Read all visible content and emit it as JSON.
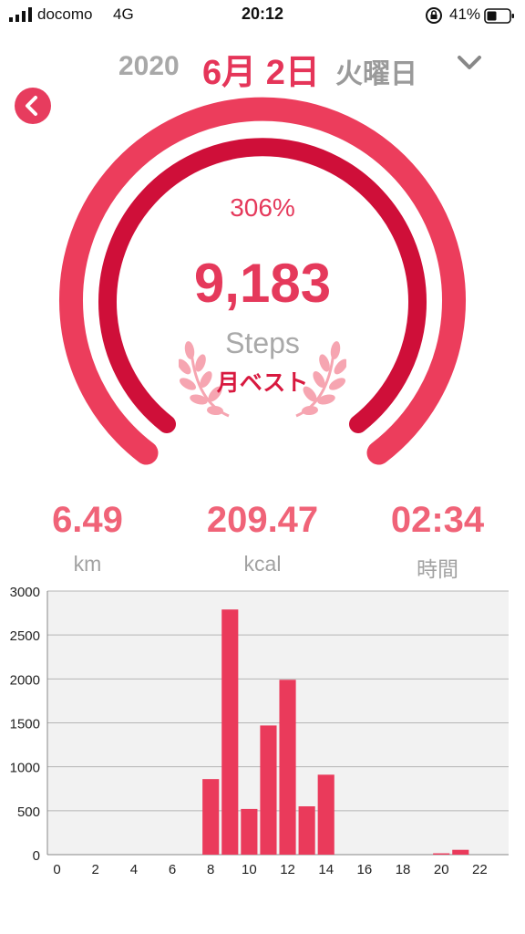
{
  "status_bar": {
    "carrier": "docomo",
    "network": "4G",
    "time": "20:12",
    "battery": "41%"
  },
  "header": {
    "year": "2020",
    "month_day": "6月 2日",
    "weekday": "火曜日"
  },
  "icons": {
    "back": "chevron-left-icon",
    "dropdown": "chevron-down-icon",
    "laurel": "laurel-icon",
    "lock": "rotation-lock-icon",
    "battery": "battery-icon",
    "signal": "signal-icon"
  },
  "summary": {
    "percent": "306%",
    "steps": "9,183",
    "steps_label": "Steps",
    "badge": "月ベスト"
  },
  "stats": [
    {
      "value": "6.49",
      "unit": "km"
    },
    {
      "value": "209.47",
      "unit": "kcal"
    },
    {
      "value": "02:34",
      "unit": "時間"
    }
  ],
  "colors": {
    "accent": "#e53559",
    "outer_ring": "#ec3d5c",
    "inner_ring": "#cf0f39",
    "bar": "#ea3a5b",
    "chart_bg": "#f2f2f2"
  },
  "chart_data": {
    "type": "bar",
    "x": [
      0,
      1,
      2,
      3,
      4,
      5,
      6,
      7,
      8,
      9,
      10,
      11,
      12,
      13,
      14,
      15,
      16,
      17,
      18,
      19,
      20,
      21,
      22,
      23
    ],
    "values": [
      0,
      0,
      0,
      0,
      0,
      0,
      0,
      0,
      860,
      2790,
      520,
      1470,
      1990,
      550,
      910,
      0,
      0,
      0,
      0,
      0,
      15,
      55,
      0,
      0
    ],
    "x_ticks": [
      0,
      2,
      4,
      6,
      8,
      10,
      12,
      14,
      16,
      18,
      20,
      22
    ],
    "y_ticks": [
      0,
      500,
      1000,
      1500,
      2000,
      2500,
      3000
    ],
    "ylim": [
      0,
      3000
    ],
    "grid": true,
    "title": "",
    "xlabel": "",
    "ylabel": ""
  }
}
